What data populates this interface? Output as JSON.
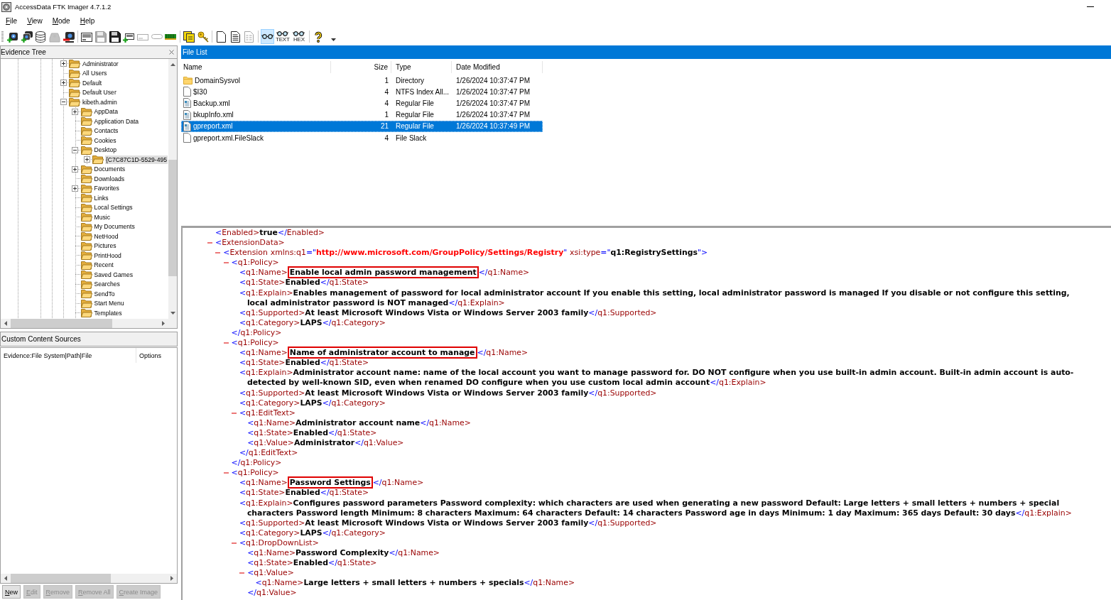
{
  "window": {
    "title": "AccessData FTK Imager 4.7.1.2"
  },
  "menu": [
    "File",
    "View",
    "Mode",
    "Help"
  ],
  "toolbar": {
    "groups": [
      {
        "items": [
          {
            "kind": "adddisk",
            "disabled": false
          },
          {
            "kind": "addall",
            "disabled": false
          },
          {
            "kind": "mount",
            "disabled": false
          },
          {
            "kind": "decrypt",
            "disabled": true
          },
          {
            "kind": "remove",
            "disabled": false
          }
        ]
      },
      {
        "items": [
          {
            "kind": "image",
            "disabled": false
          },
          {
            "kind": "export",
            "disabled": true
          },
          {
            "kind": "floppy",
            "disabled": false
          },
          {
            "kind": "addcustom",
            "disabled": false
          },
          {
            "kind": "custom",
            "disabled": true
          },
          {
            "kind": "verify",
            "disabled": true
          },
          {
            "kind": "memory",
            "disabled": false
          }
        ]
      },
      {
        "items": [
          {
            "kind": "protected",
            "disabled": false
          },
          {
            "kind": "key",
            "disabled": false
          }
        ]
      },
      {
        "items": [
          {
            "kind": "exportfiles",
            "disabled": false
          },
          {
            "kind": "hashlist",
            "disabled": false
          },
          {
            "kind": "dirlisting",
            "disabled": true
          }
        ]
      },
      {
        "items": [
          {
            "kind": "natural",
            "disabled": false,
            "selected": true
          },
          {
            "kind": "text",
            "label": "TEXT",
            "disabled": false,
            "selected": false
          },
          {
            "kind": "hex",
            "label": "HEX",
            "disabled": false,
            "selected": false
          }
        ]
      },
      {
        "items": [
          {
            "kind": "help",
            "disabled": false
          }
        ]
      }
    ]
  },
  "evidence_tree": {
    "title": "Evidence Tree",
    "nodes": [
      {
        "label": "Administrator",
        "expanded": false,
        "selected": false
      },
      {
        "label": "All Users",
        "selected": false
      },
      {
        "label": "Default",
        "expanded": false,
        "selected": false
      },
      {
        "label": "Default User",
        "selected": false
      },
      {
        "label": "kibeth.admin",
        "expanded": true,
        "selected": false,
        "children": [
          {
            "label": "AppData",
            "expanded": false,
            "selected": false
          },
          {
            "label": "Application Data",
            "selected": false
          },
          {
            "label": "Contacts",
            "selected": false
          },
          {
            "label": "Cookies",
            "selected": false
          },
          {
            "label": "Desktop",
            "expanded": true,
            "selected": false,
            "children": [
              {
                "label": "{C7C87C1D-5529-495",
                "expanded": false,
                "selected": true
              }
            ]
          },
          {
            "label": "Documents",
            "expanded": false,
            "selected": false
          },
          {
            "label": "Downloads",
            "selected": false
          },
          {
            "label": "Favorites",
            "expanded": false,
            "selected": false
          },
          {
            "label": "Links",
            "selected": false
          },
          {
            "label": "Local Settings",
            "selected": false
          },
          {
            "label": "Music",
            "selected": false
          },
          {
            "label": "My Documents",
            "selected": false
          },
          {
            "label": "NetHood",
            "selected": false
          },
          {
            "label": "Pictures",
            "selected": false
          },
          {
            "label": "PrintHood",
            "selected": false
          },
          {
            "label": "Recent",
            "selected": false
          },
          {
            "label": "Saved Games",
            "selected": false
          },
          {
            "label": "Searches",
            "selected": false
          },
          {
            "label": "SendTo",
            "selected": false
          },
          {
            "label": "Start Menu",
            "selected": false
          },
          {
            "label": "Templates",
            "selected": false
          }
        ]
      }
    ]
  },
  "custom_content_sources": {
    "title": "Custom Content Sources",
    "columns": [
      "Evidence:File System|Path|File",
      "Options"
    ],
    "buttons": [
      {
        "label": "New",
        "disabled": false
      },
      {
        "label": "Edit",
        "disabled": true
      },
      {
        "label": "Remove",
        "disabled": true
      },
      {
        "label": "Remove All",
        "disabled": true
      },
      {
        "label": "Create Image",
        "disabled": true
      }
    ]
  },
  "file_list": {
    "title": "File List",
    "columns": [
      "Name",
      "Size",
      "Type",
      "Date Modified"
    ],
    "rows": [
      {
        "kind": "folder",
        "name": "DomainSysvol",
        "size": "1",
        "type": "Directory",
        "date_modified": "1/26/2024 10:37:47 PM",
        "selected": false
      },
      {
        "kind": "file",
        "name": "$I30",
        "size": "4",
        "type": "NTFS Index All...",
        "date_modified": "1/26/2024 10:37:47 PM",
        "selected": false
      },
      {
        "kind": "xmlfile",
        "name": "Backup.xml",
        "size": "4",
        "type": "Regular File",
        "date_modified": "1/26/2024 10:37:47 PM",
        "selected": false
      },
      {
        "kind": "xmlfile",
        "name": "bkupInfo.xml",
        "size": "1",
        "type": "Regular File",
        "date_modified": "1/26/2024 10:37:47 PM",
        "selected": false
      },
      {
        "kind": "xmlfile",
        "name": "gpreport.xml",
        "size": "21",
        "type": "Regular File",
        "date_modified": "1/26/2024 10:37:49 PM",
        "selected": true
      },
      {
        "kind": "file",
        "name": "gpreport.xml.FileSlack",
        "size": "4",
        "type": "File Slack",
        "selected": false
      }
    ]
  },
  "xml_view": {
    "nodes": [
      {
        "kind": "leaf",
        "open": "<Enabled>",
        "text": "true",
        "close": "</Enabled>",
        "boxed": false
      },
      {
        "kind": "element",
        "open": "<ExtensionData>",
        "expanded": true,
        "children": [
          {
            "kind": "element",
            "open": "<Extension",
            "attributes": [
              {
                "kind": "namespace",
                "name": "xmlns:q1",
                "value": "=\"http://www.microsoft.com/GroupPolicy/Settings/Registry\""
              },
              {
                "kind": "plain",
                "name": "xsi:type",
                "value": "=\"q1:RegistrySettings\""
              }
            ],
            "open_end": ">",
            "expanded": true,
            "children": [
              {
                "kind": "element",
                "open": "<q1:Policy>",
                "expanded": true,
                "children": [
                  {
                    "kind": "leaf",
                    "open": "<q1:Name>",
                    "text": "Enable local admin password management",
                    "close": "</q1:Name>",
                    "boxed": true
                  },
                  {
                    "kind": "leaf",
                    "open": "<q1:State>",
                    "text": "Enabled",
                    "close": "</q1:State>",
                    "boxed": false
                  },
                  {
                    "kind": "paragraph",
                    "open": "<q1:Explain>",
                    "text": "Enables management of password for local administrator account If you enable this setting, local administrator password is managed If you disable or not configure this setting, local administrator password is NOT managed",
                    "close": "</q1:Explain>"
                  },
                  {
                    "kind": "leaf",
                    "open": "<q1:Supported>",
                    "text": "At least Microsoft Windows Vista or Windows Server 2003 family",
                    "close": "</q1:Supported>",
                    "boxed": false
                  },
                  {
                    "kind": "leaf",
                    "open": "<q1:Category>",
                    "text": "LAPS",
                    "close": "</q1:Category>",
                    "boxed": false
                  }
                ],
                "close": "</q1:Policy>"
              },
              {
                "kind": "element",
                "open": "<q1:Policy>",
                "expanded": true,
                "children": [
                  {
                    "kind": "leaf",
                    "open": "<q1:Name>",
                    "text": "Name of administrator account to manage",
                    "close": "</q1:Name>",
                    "boxed": true
                  },
                  {
                    "kind": "leaf",
                    "open": "<q1:State>",
                    "text": "Enabled",
                    "close": "</q1:State>",
                    "boxed": false
                  },
                  {
                    "kind": "paragraph",
                    "open": "<q1:Explain>",
                    "text": "Administrator account name: name of the local account you want to manage password for. DO NOT configure when you use built-in admin account. Built-in admin account is auto-detected by well-known SID, even when renamed DO configure when you use custom local admin account",
                    "close": "</q1:Explain>"
                  },
                  {
                    "kind": "leaf",
                    "open": "<q1:Supported>",
                    "text": "At least Microsoft Windows Vista or Windows Server 2003 family",
                    "close": "</q1:Supported>",
                    "boxed": false
                  },
                  {
                    "kind": "leaf",
                    "open": "<q1:Category>",
                    "text": "LAPS",
                    "close": "</q1:Category>",
                    "boxed": false
                  },
                  {
                    "kind": "element",
                    "open": "<q1:EditText>",
                    "expanded": true,
                    "children": [
                      {
                        "kind": "leaf",
                        "open": "<q1:Name>",
                        "text": "Administrator account name",
                        "close": "</q1:Name>",
                        "boxed": false
                      },
                      {
                        "kind": "leaf",
                        "open": "<q1:State>",
                        "text": "Enabled",
                        "close": "</q1:State>",
                        "boxed": false
                      },
                      {
                        "kind": "leaf",
                        "open": "<q1:Value>",
                        "text": "Administrator",
                        "close": "</q1:Value>",
                        "boxed": false
                      }
                    ],
                    "close": "</q1:EditText>"
                  }
                ],
                "close": "</q1:Policy>"
              },
              {
                "kind": "element",
                "open": "<q1:Policy>",
                "expanded": true,
                "children": [
                  {
                    "kind": "leaf",
                    "open": "<q1:Name>",
                    "text": "Password Settings",
                    "close": "</q1:Name>",
                    "boxed": true
                  },
                  {
                    "kind": "leaf",
                    "open": "<q1:State>",
                    "text": "Enabled",
                    "close": "</q1:State>",
                    "boxed": false
                  },
                  {
                    "kind": "paragraph",
                    "open": "<q1:Explain>",
                    "text": "Configures password parameters Password complexity: which characters are used when generating a new password Default: Large letters + small letters + numbers + special characters Password length Minimum: 8 characters Maximum: 64 characters Default: 14 characters Password age in days Minimum: 1 day Maximum: 365 days Default: 30 days",
                    "close": "</q1:Explain>"
                  },
                  {
                    "kind": "leaf",
                    "open": "<q1:Supported>",
                    "text": "At least Microsoft Windows Vista or Windows Server 2003 family",
                    "close": "</q1:Supported>",
                    "boxed": false
                  },
                  {
                    "kind": "leaf",
                    "open": "<q1:Category>",
                    "text": "LAPS",
                    "close": "</q1:Category>",
                    "boxed": false
                  },
                  {
                    "kind": "element",
                    "open": "<q1:DropDownList>",
                    "expanded": true,
                    "children": [
                      {
                        "kind": "leaf",
                        "open": "<q1:Name>",
                        "text": "Password Complexity",
                        "close": "</q1:Name>",
                        "boxed": false
                      },
                      {
                        "kind": "leaf",
                        "open": "<q1:State>",
                        "text": "Enabled",
                        "close": "</q1:State>",
                        "boxed": false
                      },
                      {
                        "kind": "element",
                        "open": "<q1:Value>",
                        "expanded": true,
                        "children": [
                          {
                            "kind": "leaf",
                            "open": "<q1:Name>",
                            "text": "Large letters + small letters + numbers + specials",
                            "close": "</q1:Name>",
                            "boxed": false
                          }
                        ],
                        "close": "</q1:Value>"
                      }
                    ]
                  }
                ]
              }
            ]
          }
        ]
      }
    ]
  }
}
